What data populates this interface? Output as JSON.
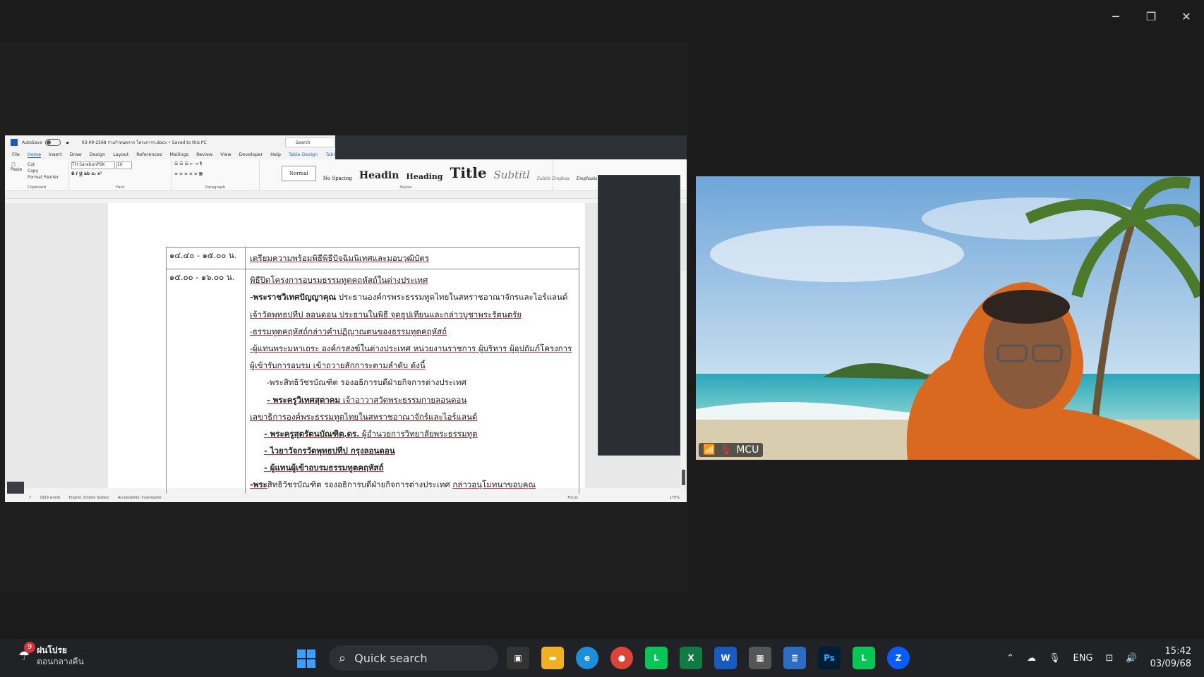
{
  "window_controls": {
    "minimize": "─",
    "restore": "❐",
    "close": "✕"
  },
  "word": {
    "autosave_label": "AutoSave",
    "autosave_state": "Off",
    "filename": "03-09-2568 ร่างกำหนดการ โครงการฯ.docx • Saved to this PC",
    "search_placeholder": "Search",
    "tabs": [
      "File",
      "Home",
      "Insert",
      "Draw",
      "Design",
      "Layout",
      "References",
      "Mailings",
      "Review",
      "View",
      "Developer",
      "Help",
      "Table Design",
      "Table Layout"
    ],
    "active_tab": "Home",
    "clipboard": {
      "paste": "Paste",
      "cut": "Cut",
      "copy": "Copy",
      "format_painter": "Format Painter",
      "label": "Clipboard"
    },
    "font": {
      "name": "TH SarabunPSK",
      "size": "16",
      "label": "Font"
    },
    "paragraph_label": "Paragraph",
    "styles_label": "Styles",
    "styles": [
      "Normal",
      "No Spacing",
      "Headin",
      "Heading",
      "Title",
      "Subtitl",
      "Subtle Emphas",
      "Emphasis"
    ],
    "status": {
      "page": "7",
      "words": "1929 words",
      "language": "English (United States)",
      "accessibility": "Accessibility: Investigate",
      "focus": "Focus",
      "zoom": "170%"
    }
  },
  "table": {
    "row1": {
      "time": "๑๔.๔๐ - ๑๕.๐๐ น.",
      "text": "เตรียมความพร้อมพิธีพิธีปัจฉิมนิเทศและมอบวุฒิบัตร"
    },
    "row2": {
      "time": "๑๕.๐๐ - ๑๖.๐๐ น.",
      "l1": "พิธีปิดโครงการอบรมธรรมทูตคฤหัสถ์ในต่างประเทศ",
      "l2a": "-พระราชวิเทศปัญญาคุณ",
      "l2b": " ประธานองค์กรพระธรรมทูตไทยในสหราชอาณาจักรและไอร์แลนด์",
      "l3": "เจ้าวัดพุทธปทีป ลอนดอน ประธานในพิธี จุดธูปเทียนและกล่าวบูชาพระรัตนตรัย",
      "l4": "-ธรรมทูตคฤหัสถ์กล่าวคำปฏิญาณตนของธรรมทูตคฤหัสถ์",
      "l5": "-ผู้แทนพระมหาเถระ องค์กรสงฆ์ในต่างประเทศ หน่วยงานราชการ ผู้บริหาร ผู้อุปถัมภ์โครงการ",
      "l6": "ผู้เข้ารับการอบรม เข้าถวายสักการะตามลำดับ ดังนี้",
      "l7": "-พระสิทธิวัชรบัณฑิต รองอธิการบดีฝ่ายกิจการต่างประเทศ",
      "l8a": "- พระครูวิเทศสุตาคม",
      "l8b": " เจ้าอาวาสวัดพระธรรมกายลอนดอน",
      "l9": "เลขาธิการองค์พระธรรมทูตไทยในสหราชอาณาจักร์และไอร์แลนด์",
      "l10a": "- พระครูสุตรัตนบัณฑิต,ดร.",
      "l10b": " ผู้อำนวยการวิทยาลัยพระธรรมทูต",
      "l11a": "- ไวยาวัจกรวัดพุทธปทีป",
      "l11b": " กรุงลอนดอน",
      "l12": "- ผู้แทนผู้เข้าอบรมธรรมทูตคฤหัสถ์",
      "l13a": "-พระ",
      "l13b": "สิทธิวัชรบัณฑิต รองอธิการบดีฝ่ายกิจการต่างประเทศ ",
      "l13c": "กล่าวอนุโมทนาขอบคุณ"
    }
  },
  "video": {
    "name": "MCU"
  },
  "taskbar": {
    "weather_badge": "9",
    "weather_title": "ฝนโปรย",
    "weather_sub": "ตอนกลางคืน",
    "search_placeholder": "Quick search",
    "apps": [
      "file-explorer",
      "edge",
      "chrome",
      "line",
      "excel",
      "word",
      "calculator",
      "notepad",
      "photoshop",
      "line",
      "zoom"
    ],
    "tray_lang": "ENG",
    "time": "15:42",
    "date": "03/09/68"
  },
  "colors": {
    "word_blue": "#185abd",
    "line_green": "#06c755",
    "zoom_blue": "#0b5cff",
    "excel_green": "#107c41"
  }
}
